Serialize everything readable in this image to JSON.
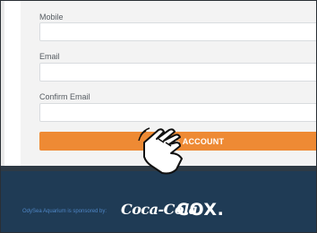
{
  "form": {
    "fields": [
      {
        "label": "Mobile",
        "value": ""
      },
      {
        "label": "Email",
        "value": ""
      },
      {
        "label": "Confirm Email",
        "value": ""
      }
    ],
    "submit_label": "CREATE ACCOUNT",
    "submit_visible_label": "TE ACCOUNT"
  },
  "footer": {
    "sponsor_text": "OdySea Aquarium is sponsored by:",
    "sponsors": [
      {
        "name": "Coca-Cola",
        "logo_text": "Coca-Cola"
      },
      {
        "name": "Cox",
        "logo_text": "COX."
      }
    ]
  },
  "colors": {
    "accent": "#ee8a34",
    "footer_bg": "#1f3b55",
    "sponsor_text": "#4e86c6",
    "form_bg": "#f3f3f3"
  },
  "cursor": {
    "icon": "hand-pointer-icon"
  }
}
